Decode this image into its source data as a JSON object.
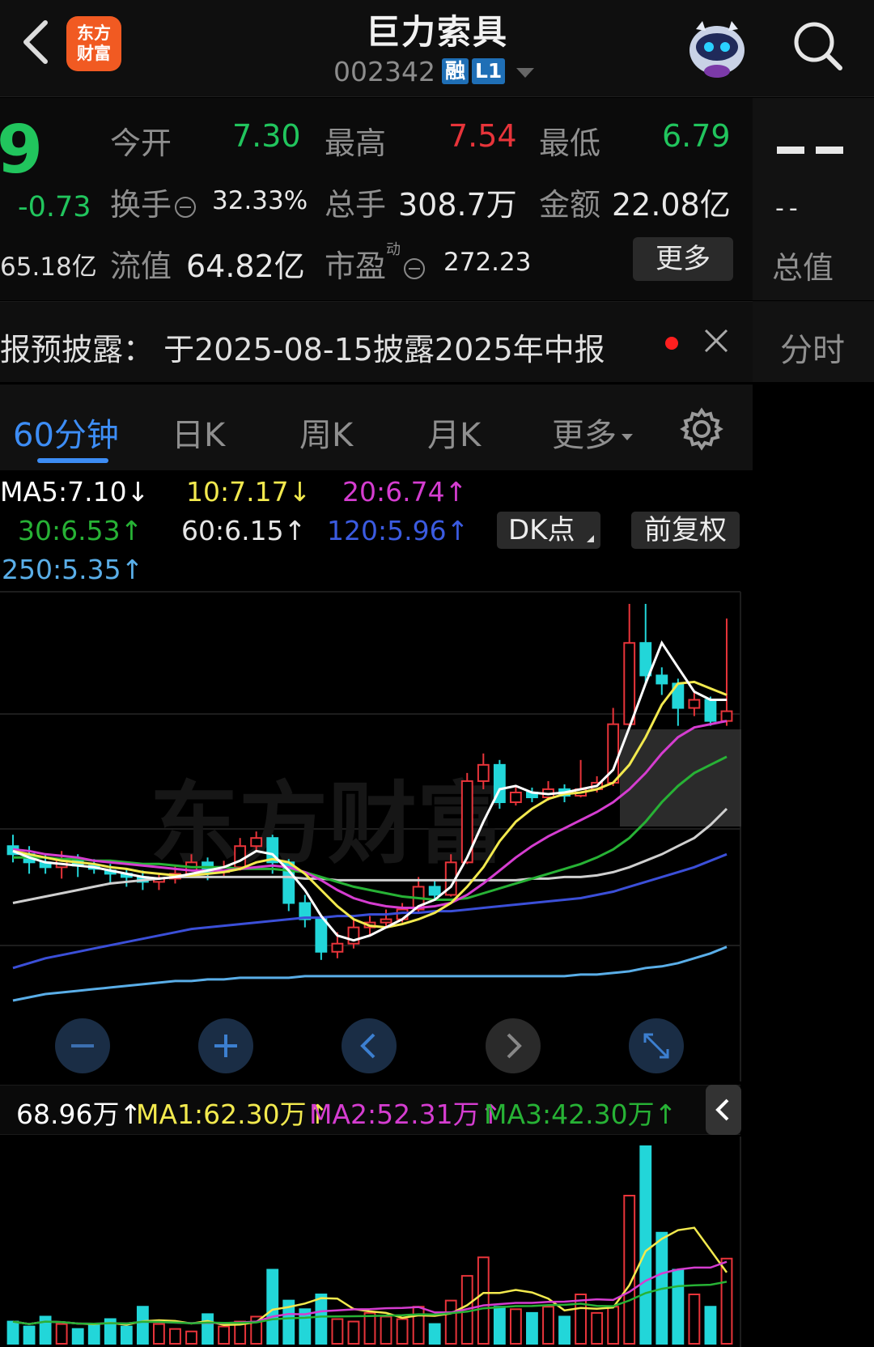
{
  "header": {
    "title": "巨力索具",
    "code": "002342",
    "tag_margin": "融",
    "tag_level": "L1",
    "logo_text": "东方财富"
  },
  "quote": {
    "price_fragment": "9",
    "change": "-0.73",
    "market_cap": "65.18亿",
    "open_label": "今开",
    "open": "7.30",
    "high_label": "最高",
    "high": "7.54",
    "low_label": "最低",
    "low": "6.79",
    "turnover_label": "换手",
    "turnover": "32.33%",
    "volume_label": "总手",
    "volume": "308.7万",
    "amount_label": "金额",
    "amount": "22.08亿",
    "float_label": "流值",
    "float_cap": "64.82亿",
    "pe_label": "市盈",
    "pe_sup": "动",
    "pe": "272.23",
    "more_label": "更多",
    "right_dash_small": "--",
    "total_label": "总值"
  },
  "disclosure": {
    "text": "报预披露：  于2025-08-15披露2025年中报",
    "fenshi_label": "分时"
  },
  "tabs": {
    "items": [
      "60分钟",
      "日K",
      "周K",
      "月K",
      "更多"
    ],
    "active": "60分钟"
  },
  "ma": {
    "ma5": "MA5:7.10↓",
    "ma10": "10:7.17↓",
    "ma20": "20:6.74↑",
    "ma30": "30:6.53↑",
    "ma60": "60:6.15↑",
    "ma120": "120:5.96↑",
    "ma250": "250:5.35↑",
    "dk_label": "DK点",
    "fq_label": "前复权"
  },
  "volume_legend": {
    "vol": "68.96万↑",
    "ma1": "MA1:62.30万↑",
    "ma2": "MA2:52.31万↑",
    "ma3": "MA3:42.30万↑"
  },
  "colors": {
    "up": "#e8343a",
    "down": "#22d6d9",
    "green": "#21c55d",
    "ma5": "#ffffff",
    "ma10": "#f2e94e",
    "ma20": "#d53dd0",
    "ma30": "#27b235",
    "ma60": "#cfcfcf",
    "ma120": "#3b4fd8",
    "ma250": "#5aaee8",
    "accent": "#3d8df5"
  },
  "chart_data": {
    "type": "candlestick",
    "title": "",
    "series_names": [
      "MA5",
      "MA10",
      "MA20",
      "MA30",
      "MA60",
      "MA120",
      "MA250"
    ],
    "price_range": [
      5.1,
      7.6
    ],
    "candles": [
      {
        "o": 6.05,
        "c": 6.0,
        "h": 6.12,
        "l": 5.95
      },
      {
        "o": 6.0,
        "c": 5.95,
        "h": 6.05,
        "l": 5.88
      },
      {
        "o": 5.95,
        "c": 5.92,
        "h": 6.0,
        "l": 5.88
      },
      {
        "o": 5.92,
        "c": 5.97,
        "h": 6.02,
        "l": 5.85
      },
      {
        "o": 5.97,
        "c": 5.93,
        "h": 6.0,
        "l": 5.86
      },
      {
        "o": 5.93,
        "c": 5.91,
        "h": 5.97,
        "l": 5.88
      },
      {
        "o": 5.9,
        "c": 5.88,
        "h": 5.94,
        "l": 5.82
      },
      {
        "o": 5.88,
        "c": 5.86,
        "h": 5.91,
        "l": 5.8
      },
      {
        "o": 5.86,
        "c": 5.83,
        "h": 5.9,
        "l": 5.78
      },
      {
        "o": 5.83,
        "c": 5.85,
        "h": 5.88,
        "l": 5.78
      },
      {
        "o": 5.85,
        "c": 5.88,
        "h": 5.93,
        "l": 5.82
      },
      {
        "o": 5.88,
        "c": 5.95,
        "h": 6.0,
        "l": 5.86
      },
      {
        "o": 5.95,
        "c": 5.89,
        "h": 5.98,
        "l": 5.84
      },
      {
        "o": 5.89,
        "c": 5.92,
        "h": 5.96,
        "l": 5.86
      },
      {
        "o": 5.92,
        "c": 6.05,
        "h": 6.1,
        "l": 5.9
      },
      {
        "o": 6.05,
        "c": 6.1,
        "h": 6.14,
        "l": 6.02
      },
      {
        "o": 6.1,
        "c": 5.95,
        "h": 6.12,
        "l": 5.88
      },
      {
        "o": 5.95,
        "c": 5.7,
        "h": 5.97,
        "l": 5.65
      },
      {
        "o": 5.7,
        "c": 5.6,
        "h": 5.75,
        "l": 5.55
      },
      {
        "o": 5.6,
        "c": 5.4,
        "h": 5.62,
        "l": 5.35
      },
      {
        "o": 5.4,
        "c": 5.45,
        "h": 5.52,
        "l": 5.36
      },
      {
        "o": 5.45,
        "c": 5.55,
        "h": 5.6,
        "l": 5.42
      },
      {
        "o": 5.55,
        "c": 5.58,
        "h": 5.62,
        "l": 5.5
      },
      {
        "o": 5.58,
        "c": 5.6,
        "h": 5.66,
        "l": 5.55
      },
      {
        "o": 5.6,
        "c": 5.66,
        "h": 5.7,
        "l": 5.58
      },
      {
        "o": 5.66,
        "c": 5.8,
        "h": 5.86,
        "l": 5.64
      },
      {
        "o": 5.8,
        "c": 5.75,
        "h": 5.84,
        "l": 5.72
      },
      {
        "o": 5.75,
        "c": 5.95,
        "h": 6.0,
        "l": 5.74
      },
      {
        "o": 5.95,
        "c": 6.45,
        "h": 6.5,
        "l": 5.94
      },
      {
        "o": 6.45,
        "c": 6.55,
        "h": 6.62,
        "l": 6.4
      },
      {
        "o": 6.55,
        "c": 6.32,
        "h": 6.58,
        "l": 6.28
      },
      {
        "o": 6.32,
        "c": 6.38,
        "h": 6.42,
        "l": 6.3
      },
      {
        "o": 6.38,
        "c": 6.35,
        "h": 6.41,
        "l": 6.32
      },
      {
        "o": 6.35,
        "c": 6.4,
        "h": 6.45,
        "l": 6.33
      },
      {
        "o": 6.4,
        "c": 6.36,
        "h": 6.43,
        "l": 6.32
      },
      {
        "o": 6.36,
        "c": 6.4,
        "h": 6.58,
        "l": 6.35
      },
      {
        "o": 6.4,
        "c": 6.44,
        "h": 6.48,
        "l": 6.38
      },
      {
        "o": 6.44,
        "c": 6.8,
        "h": 6.9,
        "l": 6.42
      },
      {
        "o": 6.8,
        "c": 7.3,
        "h": 7.54,
        "l": 6.78
      },
      {
        "o": 7.3,
        "c": 7.1,
        "h": 7.54,
        "l": 7.05
      },
      {
        "o": 7.1,
        "c": 7.05,
        "h": 7.15,
        "l": 6.98
      },
      {
        "o": 7.05,
        "c": 6.9,
        "h": 7.08,
        "l": 6.79
      },
      {
        "o": 6.9,
        "c": 6.95,
        "h": 7.0,
        "l": 6.85
      },
      {
        "o": 6.95,
        "c": 6.82,
        "h": 6.97,
        "l": 6.79
      },
      {
        "o": 6.82,
        "c": 6.88,
        "h": 7.45,
        "l": 6.79
      }
    ],
    "ma5": [
      6.02,
      5.98,
      5.95,
      5.94,
      5.93,
      5.92,
      5.9,
      5.88,
      5.86,
      5.85,
      5.86,
      5.88,
      5.9,
      5.92,
      5.96,
      6.02,
      6.0,
      5.9,
      5.78,
      5.62,
      5.5,
      5.47,
      5.5,
      5.55,
      5.6,
      5.68,
      5.72,
      5.8,
      5.98,
      6.2,
      6.4,
      6.42,
      6.38,
      6.37,
      6.38,
      6.4,
      6.42,
      6.52,
      6.78,
      7.05,
      7.3,
      7.15,
      7.0,
      6.95,
      6.95
    ],
    "ma10": [
      6.02,
      6.0,
      5.98,
      5.96,
      5.95,
      5.94,
      5.92,
      5.91,
      5.89,
      5.88,
      5.87,
      5.87,
      5.88,
      5.89,
      5.91,
      5.95,
      5.97,
      5.95,
      5.88,
      5.78,
      5.68,
      5.6,
      5.56,
      5.55,
      5.57,
      5.6,
      5.64,
      5.7,
      5.8,
      5.92,
      6.08,
      6.2,
      6.28,
      6.34,
      6.37,
      6.38,
      6.4,
      6.44,
      6.55,
      6.72,
      6.92,
      7.05,
      7.06,
      7.02,
      6.98
    ],
    "ma20": [
      6.03,
      6.02,
      6.0,
      5.99,
      5.98,
      5.96,
      5.95,
      5.94,
      5.93,
      5.92,
      5.91,
      5.9,
      5.9,
      5.9,
      5.91,
      5.92,
      5.93,
      5.92,
      5.89,
      5.84,
      5.78,
      5.73,
      5.7,
      5.68,
      5.67,
      5.67,
      5.68,
      5.7,
      5.75,
      5.82,
      5.9,
      5.98,
      6.05,
      6.11,
      6.16,
      6.21,
      6.26,
      6.32,
      6.4,
      6.5,
      6.62,
      6.72,
      6.78,
      6.8,
      6.82
    ],
    "ma30": [
      5.98,
      5.98,
      5.98,
      5.97,
      5.97,
      5.96,
      5.96,
      5.95,
      5.94,
      5.94,
      5.93,
      5.92,
      5.92,
      5.92,
      5.91,
      5.91,
      5.91,
      5.9,
      5.89,
      5.86,
      5.83,
      5.8,
      5.78,
      5.76,
      5.74,
      5.73,
      5.72,
      5.72,
      5.73,
      5.76,
      5.79,
      5.82,
      5.85,
      5.88,
      5.91,
      5.94,
      5.98,
      6.03,
      6.1,
      6.2,
      6.32,
      6.42,
      6.5,
      6.55,
      6.6
    ],
    "ma60": [
      5.7,
      5.72,
      5.74,
      5.76,
      5.78,
      5.8,
      5.82,
      5.83,
      5.84,
      5.85,
      5.86,
      5.86,
      5.86,
      5.86,
      5.86,
      5.86,
      5.86,
      5.86,
      5.85,
      5.85,
      5.84,
      5.84,
      5.84,
      5.84,
      5.84,
      5.84,
      5.84,
      5.84,
      5.84,
      5.84,
      5.84,
      5.84,
      5.85,
      5.85,
      5.86,
      5.86,
      5.87,
      5.89,
      5.92,
      5.96,
      6.0,
      6.05,
      6.1,
      6.18,
      6.28
    ],
    "ma120": [
      5.3,
      5.33,
      5.36,
      5.38,
      5.4,
      5.42,
      5.44,
      5.46,
      5.48,
      5.5,
      5.52,
      5.54,
      5.55,
      5.56,
      5.57,
      5.58,
      5.59,
      5.6,
      5.61,
      5.61,
      5.62,
      5.62,
      5.63,
      5.63,
      5.64,
      5.64,
      5.65,
      5.65,
      5.66,
      5.67,
      5.68,
      5.69,
      5.7,
      5.71,
      5.72,
      5.73,
      5.75,
      5.77,
      5.8,
      5.83,
      5.86,
      5.89,
      5.92,
      5.96,
      6.0
    ],
    "ma250": [
      5.1,
      5.12,
      5.14,
      5.15,
      5.16,
      5.17,
      5.18,
      5.19,
      5.2,
      5.21,
      5.22,
      5.22,
      5.23,
      5.23,
      5.24,
      5.24,
      5.24,
      5.24,
      5.25,
      5.25,
      5.25,
      5.25,
      5.25,
      5.25,
      5.25,
      5.25,
      5.25,
      5.25,
      5.25,
      5.25,
      5.25,
      5.25,
      5.25,
      5.25,
      5.25,
      5.26,
      5.26,
      5.27,
      5.28,
      5.3,
      5.31,
      5.33,
      5.36,
      5.39,
      5.43
    ],
    "volumes": [
      18,
      14,
      22,
      16,
      12,
      15,
      20,
      14,
      30,
      16,
      12,
      10,
      24,
      14,
      18,
      22,
      60,
      35,
      28,
      40,
      20,
      18,
      25,
      22,
      20,
      30,
      16,
      35,
      55,
      70,
      30,
      28,
      25,
      30,
      22,
      40,
      25,
      30,
      120,
      160,
      90,
      60,
      40,
      30,
      69
    ]
  }
}
